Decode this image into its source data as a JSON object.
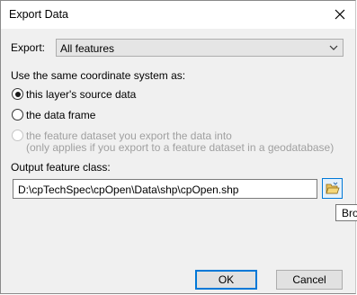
{
  "window": {
    "title": "Export Data"
  },
  "export": {
    "label": "Export:",
    "selected": "All features"
  },
  "coordinate": {
    "label": "Use the same coordinate system as:",
    "options": [
      {
        "label": "this layer's source data",
        "checked": true,
        "disabled": false
      },
      {
        "label": "the data frame",
        "checked": false,
        "disabled": false
      },
      {
        "label": "the feature dataset you export the data into",
        "sub_label": "(only applies if you export to a feature dataset in a geodatabase)",
        "checked": false,
        "disabled": true
      }
    ]
  },
  "output": {
    "label": "Output feature class:",
    "value": "D:\\cpTechSpec\\cpOpen\\Data\\shp\\cpOpen.shp",
    "tooltip": "Bro"
  },
  "buttons": {
    "ok": "OK",
    "cancel": "Cancel"
  },
  "colors": {
    "accent": "#0078d7",
    "dialog_bg": "#f0f0f0",
    "disabled_text": "#a0a0a0"
  }
}
